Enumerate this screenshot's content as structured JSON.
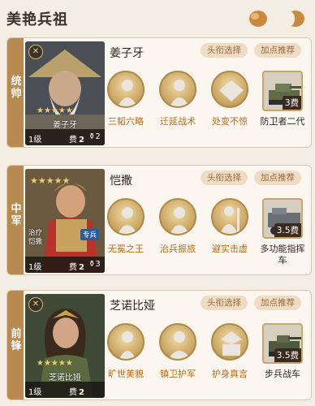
{
  "header": {
    "title": "美艳兵祖",
    "icons": [
      "orb-icon",
      "orb-icon-faded"
    ]
  },
  "actions": {
    "pick_title": "头衔选择",
    "recommend": "加点推荐"
  },
  "cards": [
    {
      "role": "统帅",
      "hero": {
        "name": "姜子牙",
        "level": "1级",
        "cost_label": "费",
        "cost": "2",
        "count": "2",
        "stars": "★★★★★"
      },
      "tactics": [
        "三韬六略",
        "迁延战术",
        "处变不惊"
      ],
      "unit": {
        "cost": "3费",
        "name": "防卫者二代"
      }
    },
    {
      "role": "中军",
      "hero": {
        "name": "恺撒",
        "level": "1级",
        "cost_label": "费",
        "cost": "2",
        "count": "3",
        "stars": "★★★★★",
        "tag": "治疗",
        "tag_name": "恺撒",
        "special": "专兵"
      },
      "tactics": [
        "无冕之王",
        "治兵振旅",
        "避实击虚"
      ],
      "unit": {
        "cost": "3.5费",
        "name": "多功能指挥车"
      }
    },
    {
      "role": "前锋",
      "hero": {
        "name": "芝诺比娅",
        "level": "1级",
        "cost_label": "费",
        "cost": "2",
        "stars": "★★★★★"
      },
      "tactics": [
        "旷世美貌",
        "镇卫护军",
        "护身真言"
      ],
      "unit": {
        "cost": "3.5费",
        "name": "步兵战车"
      }
    }
  ]
}
